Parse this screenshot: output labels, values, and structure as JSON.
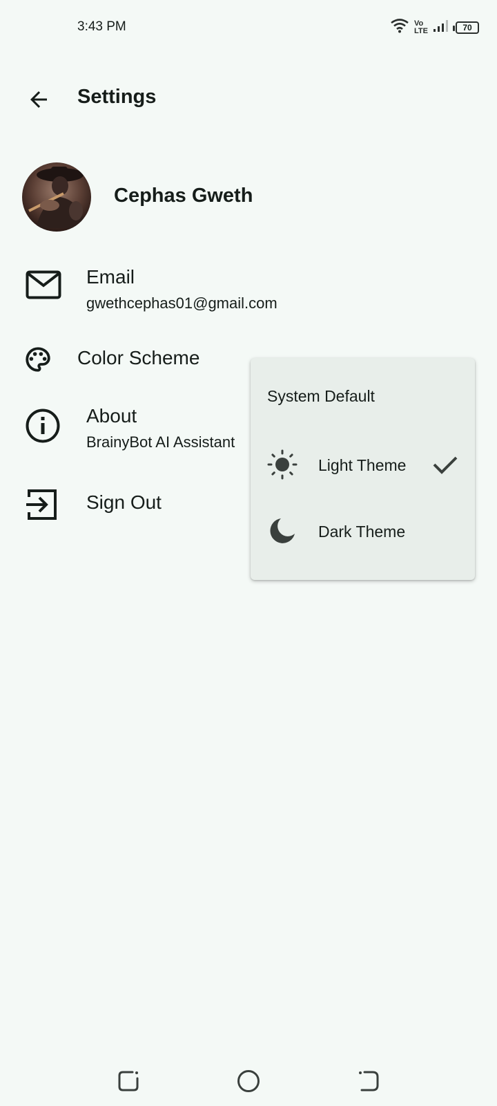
{
  "status_bar": {
    "time": "3:43 PM",
    "network_top": "Vo",
    "network_bottom": "LTE",
    "battery": "70"
  },
  "header": {
    "title": "Settings"
  },
  "profile": {
    "name": "Cephas Gweth"
  },
  "settings": {
    "email_title": "Email",
    "email_value": "gwethcephas01@gmail.com",
    "color_scheme_title": "Color Scheme",
    "about_title": "About",
    "about_value": "BrainyBot AI Assistant",
    "sign_out_title": "Sign Out"
  },
  "color_menu": {
    "options": [
      {
        "label": "System Default",
        "selected": false
      },
      {
        "label": "Light Theme",
        "selected": true
      },
      {
        "label": "Dark Theme",
        "selected": false
      }
    ]
  },
  "colors": {
    "background": "#f4f9f6",
    "menu_background": "#e8eeea",
    "text": "#161d1a",
    "icon": "#3a403d"
  }
}
